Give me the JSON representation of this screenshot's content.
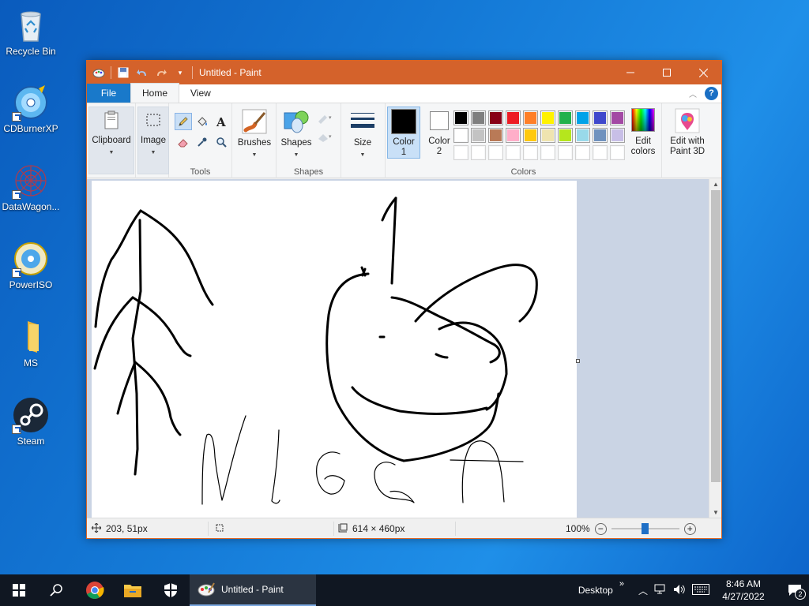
{
  "desktop": {
    "icons": [
      {
        "label": "Recycle Bin"
      },
      {
        "label": "CDBurnerXP"
      },
      {
        "label": "DataWagon..."
      },
      {
        "label": "PowerISO"
      },
      {
        "label": "MS"
      },
      {
        "label": "Steam"
      }
    ]
  },
  "window": {
    "title": "Untitled - Paint",
    "tabs": {
      "file": "File",
      "home": "Home",
      "view": "View"
    },
    "ribbon": {
      "clipboard": "Clipboard",
      "image": "Image",
      "tools": "Tools",
      "brushes": "Brushes",
      "shapes_btn": "Shapes",
      "shapes_group": "Shapes",
      "size": "Size",
      "color1": "Color\n1",
      "color1_a": "Color",
      "color1_b": "1",
      "color2_a": "Color",
      "color2_b": "2",
      "colors_group": "Colors",
      "edit_colors_a": "Edit",
      "edit_colors_b": "colors",
      "paint3d_a": "Edit with",
      "paint3d_b": "Paint 3D"
    },
    "palette_row1": [
      "#000000",
      "#7f7f7f",
      "#880015",
      "#ed1c24",
      "#ff7f27",
      "#fff200",
      "#22b14c",
      "#00a2e8",
      "#3f48cc",
      "#a349a4"
    ],
    "palette_row2": [
      "#ffffff",
      "#c3c3c3",
      "#b97a57",
      "#ffaec9",
      "#ffc90e",
      "#efe4b0",
      "#b5e61d",
      "#99d9ea",
      "#7092be",
      "#c8bfe7"
    ],
    "palette_row3": [
      "#ffffff",
      "#ffffff",
      "#ffffff",
      "#ffffff",
      "#ffffff",
      "#ffffff",
      "#ffffff",
      "#ffffff",
      "#ffffff",
      "#ffffff"
    ],
    "color1_value": "#000000",
    "color2_value": "#ffffff",
    "status": {
      "cursor_pos": "203, 51px",
      "canvas_size": "614 × 460px",
      "zoom": "100%",
      "zoom_fraction": 0.5
    }
  },
  "taskbar": {
    "active_app": "Untitled - Paint",
    "desktop_label": "Desktop",
    "time": "8:46 AM",
    "date": "4/27/2022",
    "notification_count": "2"
  }
}
